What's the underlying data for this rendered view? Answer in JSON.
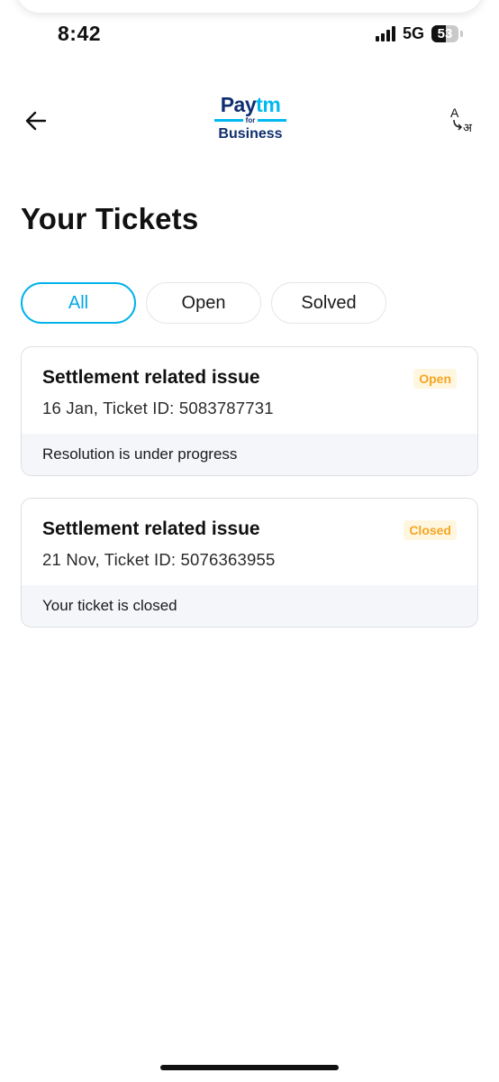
{
  "status_bar": {
    "time": "8:42",
    "network": "5G",
    "battery": "53",
    "battery_level": 0.53
  },
  "header": {
    "back_icon": "arrow-left-icon",
    "logo": {
      "line1_a": "Pay",
      "line1_b": "tm",
      "line2": "for",
      "line3": "Business"
    },
    "language_icon": "translate-icon",
    "language_label_latin": "A",
    "language_label_hindi": "अ"
  },
  "page": {
    "title": "Your Tickets"
  },
  "filters": [
    {
      "label": "All",
      "active": true
    },
    {
      "label": "Open",
      "active": false
    },
    {
      "label": "Solved",
      "active": false
    }
  ],
  "tickets": [
    {
      "title": "Settlement related issue",
      "meta": "16 Jan, Ticket ID: 5083787731",
      "status": "Open",
      "footer": "Resolution is under progress"
    },
    {
      "title": "Settlement related issue",
      "meta": "21 Nov, Ticket ID: 5076363955",
      "status": "Closed",
      "footer": "Your ticket is closed"
    }
  ],
  "colors": {
    "accent": "#00b2ea",
    "brand_navy": "#0f2e6e",
    "status_badge_text": "#f5a623",
    "status_badge_bg": "#fff6e0"
  }
}
